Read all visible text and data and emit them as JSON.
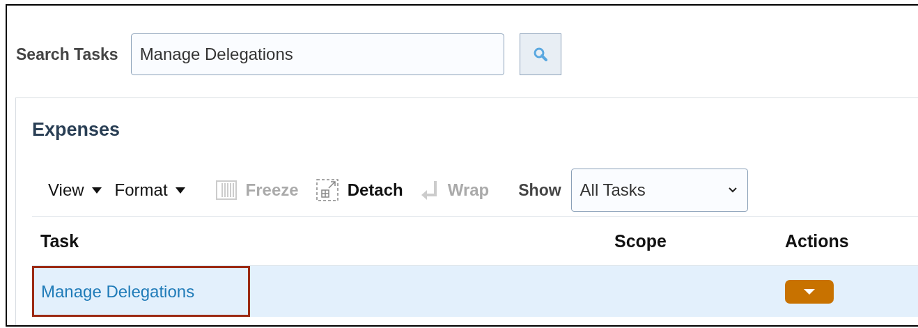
{
  "search": {
    "label": "Search Tasks",
    "value": "Manage Delegations"
  },
  "panel": {
    "title": "Expenses"
  },
  "toolbar": {
    "menus": [
      {
        "label": "View"
      },
      {
        "label": "Format"
      }
    ],
    "tools": [
      {
        "label": "Freeze",
        "kind": "freeze",
        "disabled": true
      },
      {
        "label": "Detach",
        "kind": "detach",
        "disabled": false
      },
      {
        "label": "Wrap",
        "kind": "wrap",
        "disabled": true
      }
    ],
    "show": {
      "label": "Show",
      "value": "All Tasks"
    }
  },
  "table": {
    "columns": [
      "Task",
      "Scope",
      "Actions"
    ],
    "rows": [
      {
        "task": "Manage Delegations",
        "selected": true,
        "highlighted": true
      }
    ]
  }
}
